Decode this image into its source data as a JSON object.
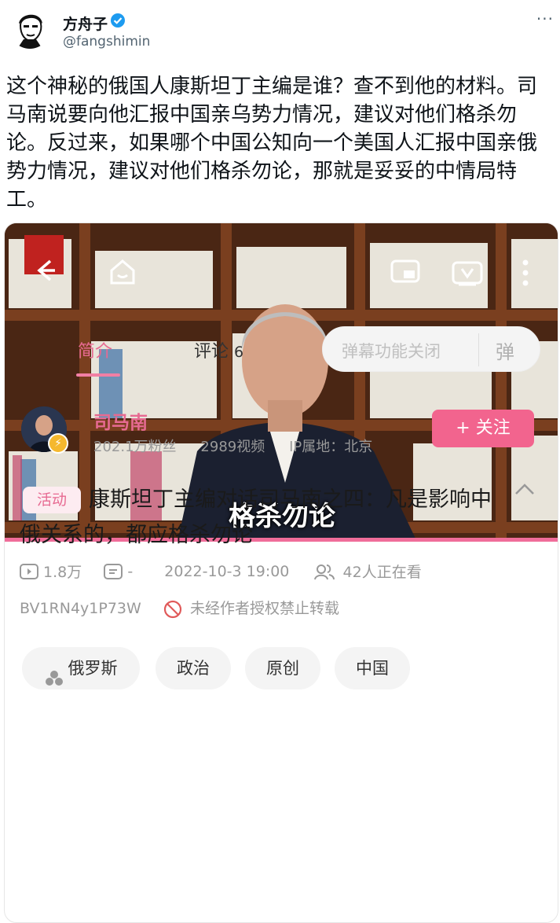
{
  "tweet": {
    "display_name": "方舟子",
    "handle": "@fangshimin",
    "more_icon": "more-icon",
    "verified_icon": "verified-badge-icon",
    "text": "这个神秘的俄国人康斯坦丁主编是谁？查不到他的材料。司马南说要向他汇报中国亲乌势力情况，建议对他们格杀勿论。反过来，如果哪个中国公知向一个美国人汇报中国亲俄势力情况，建议对他们格杀勿论，那就是妥妥的中情局特工。"
  },
  "video": {
    "caption": "格杀勿论",
    "progress_color": "#f06d9a",
    "icons": [
      "back-arrow-icon",
      "home-icon",
      "cast-icon",
      "tv-icon",
      "more-vertical-icon"
    ]
  },
  "tabs": {
    "intro": "简介",
    "comments": "评论",
    "comments_count": "6",
    "danmaku_label": "弹幕功能关闭",
    "danmaku_icon": "弹"
  },
  "uploader": {
    "name": "司马南",
    "followers": "202.1万粉丝",
    "videos": "2989视频",
    "ip": "IP属地：北京",
    "follow_label": "+ 关注"
  },
  "video_info": {
    "tag": "活动",
    "title": "康斯坦丁主编对话司马南之四：凡是影响中俄关系的，都应格杀勿论",
    "views": "1.8万",
    "danmaku_count": "-",
    "datetime": "2022-10-3 19:00",
    "watching": "42人正在看",
    "bvid": "BV1RN4y1P73W",
    "notice": "未经作者授权禁止转载"
  },
  "tags": [
    "俄罗斯",
    "政治",
    "原创",
    "中国"
  ],
  "colors": {
    "accent_pink": "#f2648e",
    "text_pink": "#e76a92",
    "twitter_verified": "#1d9bf0"
  }
}
